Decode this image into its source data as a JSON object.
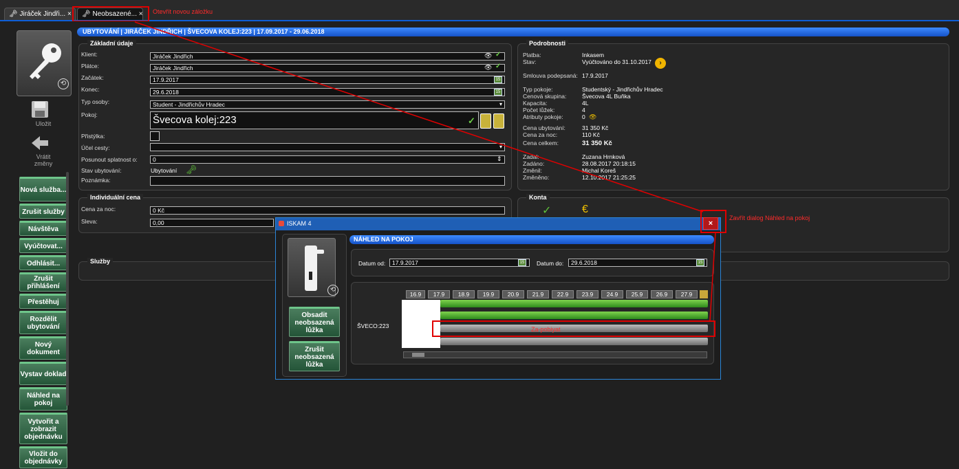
{
  "tabs": [
    {
      "label": "Jiráček Jindři...",
      "close": "×"
    },
    {
      "label": "Neobsazené...",
      "close": "×"
    }
  ],
  "annotations": {
    "new_tab": "Otevřít novou záložku",
    "close_dialog": "Zavřít dialog Náhled na pokoj",
    "occupy": "Za-pobiyat"
  },
  "header": {
    "title": "UBYTOVÁNÍ | JIRÁČEK JINDŘICH | ŠVECOVA KOLEJ:223 | 17.09.2017 - 29.06.2018"
  },
  "left": {
    "save": "Uložit",
    "revert_line1": "Vrátit",
    "revert_line2": "změny",
    "buttons": [
      "Nová služba...",
      "Zrušit služby",
      "Návštěva",
      "Vyúčtovat...",
      "Odhlásit...",
      "Zrušit přihlášení",
      "Přestěhuj",
      "Rozdělit ubytování",
      "Nový dokument",
      "Vystav doklad",
      "Náhled na pokoj",
      "Vytvořit a zobrazit objednávku",
      "Vložit do objednávky"
    ]
  },
  "basic": {
    "title": "Základní údaje",
    "labels": {
      "client": "Klient:",
      "payer": "Plátce:",
      "start": "Začátek:",
      "end": "Konec:",
      "person_type": "Typ osoby:",
      "room": "Pokoj:",
      "extra_bed": "Přistýlka:",
      "purpose": "Účel cesty:",
      "shift_due": "Posunout splatnost o:",
      "status": "Stav ubytování:",
      "note": "Poznámka:"
    },
    "values": {
      "client": "Jiráček Jindřich",
      "payer": "Jiráček Jindřich",
      "start": "17.9.2017",
      "end": "29.6.2018",
      "person_type": "Student - Jindřichův Hradec",
      "room": "Švecova kolej:223",
      "purpose": "",
      "shift_due": "0",
      "status": "Ubytování",
      "note": ""
    }
  },
  "individual": {
    "title": "Individuální cena",
    "labels": {
      "price_night": "Cena za noc:",
      "discount": "Sleva:"
    },
    "values": {
      "price_night": "0 Kč",
      "discount": "0,00"
    }
  },
  "services": {
    "title": "Služby"
  },
  "details": {
    "title": "Podrobnosti",
    "rows": [
      {
        "label": "Platba:",
        "value": "Inkasem"
      },
      {
        "label": "Stav:",
        "value": "Vyúčtováno do 31.10.2017"
      },
      {
        "label": "Smlouva podepsaná:",
        "value": "17.9.2017"
      },
      {
        "label": "Typ pokoje:",
        "value": "Studentský - Jindřichův Hradec"
      },
      {
        "label": "Cenová skupina:",
        "value": "Švecova 4L Buňka"
      },
      {
        "label": "Kapacita:",
        "value": "4L"
      },
      {
        "label": "Počet lůžek:",
        "value": "4"
      },
      {
        "label": "Atributy pokoje:",
        "value": "0"
      },
      {
        "label": "Cena ubytování:",
        "value": "31 350 Kč"
      },
      {
        "label": "Cena za noc:",
        "value": "110 Kč"
      },
      {
        "label": "Cena celkem:",
        "value": "31 350 Kč"
      },
      {
        "label": "Zadal:",
        "value": "Zuzana Hrnková"
      },
      {
        "label": "Zadáno:",
        "value": "28.08.2017 20:18:15"
      },
      {
        "label": "Změnil:",
        "value": "Michal Koreš"
      },
      {
        "label": "Změněno:",
        "value": "12.10.2017 21:25:25"
      }
    ]
  },
  "accounts": {
    "title": "Konta"
  },
  "dialog": {
    "window_title": "ISKAM 4",
    "header": "NÁHLED NA POKOJ",
    "date_from_label": "Datum od:",
    "date_from": "17.9.2017",
    "date_to_label": "Datum do:",
    "date_to": "29.6.2018",
    "room_label": "ŠVECO:223",
    "btn_occupy": "Obsadit neobsazená lůžka",
    "btn_cancel": "Zrušit neobsazená lůžka",
    "dates": [
      "16.9",
      "17.9",
      "18.9",
      "19.9",
      "20.9",
      "21.9",
      "22.9",
      "23.9",
      "24.9",
      "25.9",
      "26.9",
      "27.9"
    ]
  },
  "colors": {
    "accent": "#1f5fb5",
    "side_button": "#2f6a45",
    "annotation": "#e00000"
  }
}
